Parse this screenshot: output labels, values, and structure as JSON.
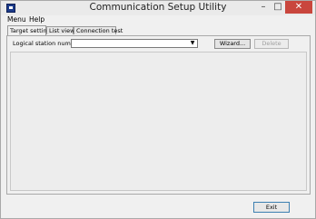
{
  "window": {
    "title": "Communication Setup Utility",
    "controls": {
      "minimize": "–",
      "maximize": "□",
      "close": "✕"
    }
  },
  "menu": [
    "Menu",
    "Help"
  ],
  "tabs": [
    {
      "label": "Target setting",
      "active": true
    },
    {
      "label": "List view",
      "active": false
    },
    {
      "label": "Connection test",
      "active": false
    }
  ],
  "target_setting": {
    "station_label": "Logical station number",
    "station_value": "",
    "dropdown_arrow": "▼",
    "wizard_label": "Wizard...",
    "delete_label": "Delete",
    "delete_enabled": false
  },
  "footer": {
    "exit_label": "Exit"
  },
  "icons": {
    "app": "app-icon",
    "dropdown": "chevron-down-icon"
  }
}
